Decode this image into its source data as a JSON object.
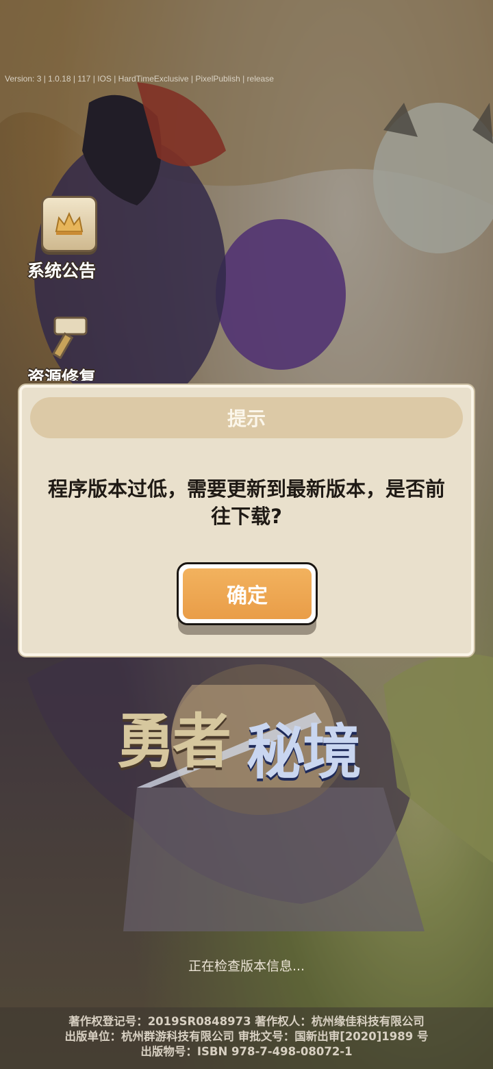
{
  "version_text": "Version: 3 | 1.0.18 | 117 | IOS | HardTimeExclusive | PixelPublish | release",
  "side_menu": {
    "announcement_label": "系统公告",
    "repair_label": "资源修复"
  },
  "logo": {
    "left": "勇者",
    "right": "秘境"
  },
  "loading_text": "正在检查版本信息...",
  "footer": {
    "line1": "著作权登记号：2019SR0848973 著作权人：杭州缘佳科技有限公司",
    "line2": "出版单位：杭州群游科技有限公司 审批文号：国新出审[2020]1989 号",
    "line3": "出版物号：ISBN 978-7-498-08072-1"
  },
  "dialog": {
    "title": "提示",
    "message": "程序版本过低，需要更新到最新版本，是否前往下载?",
    "confirm_label": "确定"
  },
  "colors": {
    "dialog_bg": "#e9e0cc",
    "title_bar": "#dcc9a6",
    "button": "#eea34f"
  }
}
